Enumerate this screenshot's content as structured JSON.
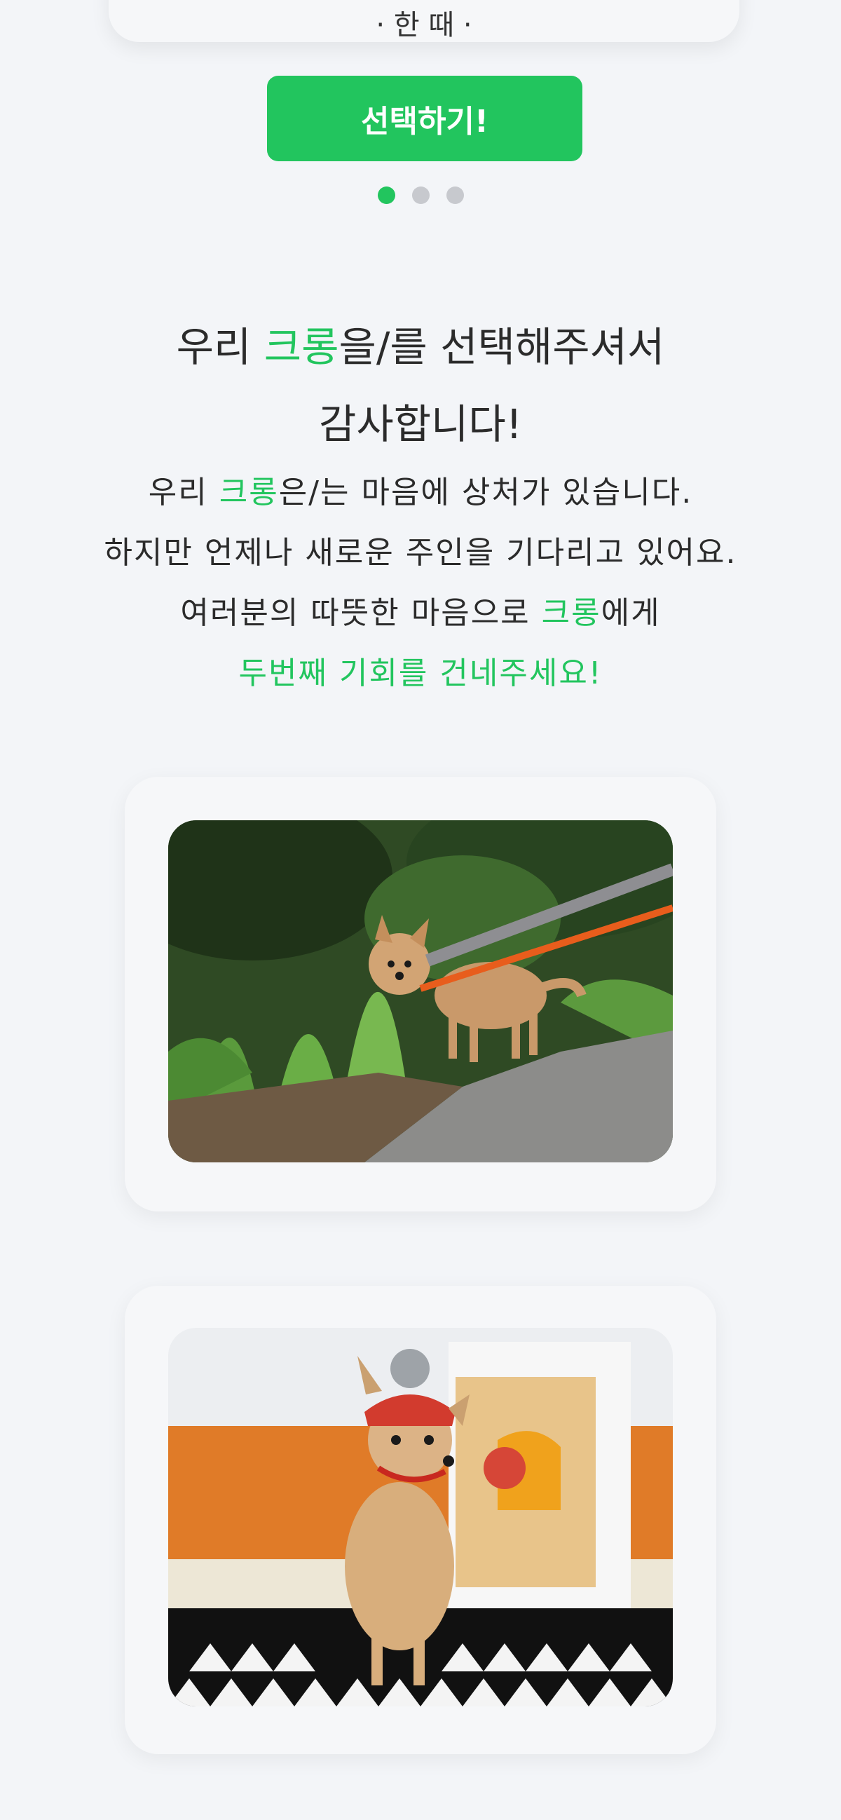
{
  "top_card": {
    "text": "· 한 때 ·"
  },
  "select_button": {
    "label": "선택하기!"
  },
  "pagination": {
    "count": 3,
    "active_index": 0
  },
  "heading": {
    "line1_pre": "우리 ",
    "line1_name": "크롱",
    "line1_post": "을/를 선택해주셔서",
    "line2": "감사합니다!"
  },
  "message": {
    "line1_pre": "우리 ",
    "line1_name": "크롱",
    "line1_post": "은/는 마음에 상처가 있습니다.",
    "line2": "하지만 언제나 새로운 주인을 기다리고 있어요.",
    "line3_pre": "여러분의 따뜻한 마음으로 ",
    "line3_name": "크롱",
    "line3_post": "에게",
    "line4": "두번째 기회를 건네주세요!"
  },
  "photos": [
    {
      "alt": "dog-on-leash-outdoors"
    },
    {
      "alt": "dog-with-knit-hat-indoors"
    }
  ],
  "colors": {
    "accent": "#22c55e",
    "background": "#f3f5f8",
    "card": "#f6f7f9",
    "text": "#2b2b2b",
    "dot_inactive": "#c7c9ce"
  }
}
